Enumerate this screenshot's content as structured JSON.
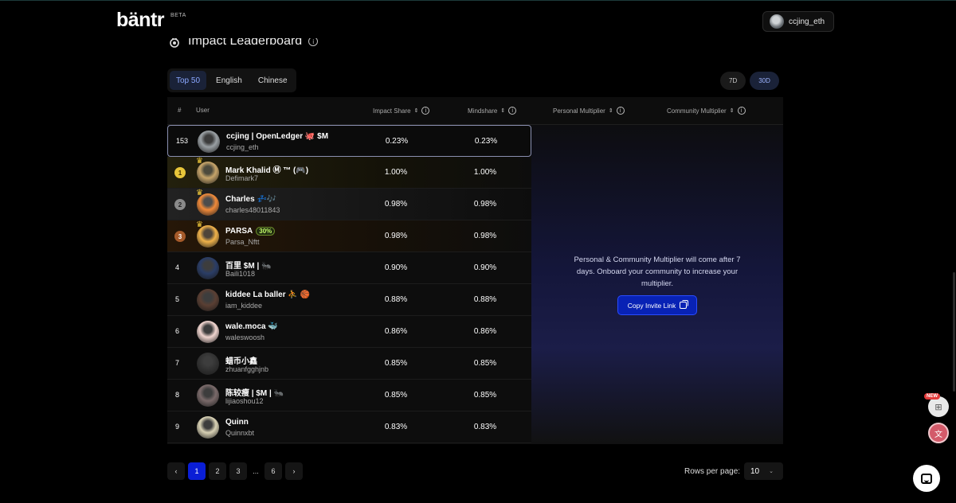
{
  "app": {
    "logo": "bäntr",
    "beta": "BETA"
  },
  "header": {
    "username": "ccjing_eth"
  },
  "page": {
    "title": "Impact Leaderboard"
  },
  "tabs": [
    {
      "label": "Top 50",
      "active": true
    },
    {
      "label": "English",
      "active": false
    },
    {
      "label": "Chinese",
      "active": false
    }
  ],
  "periods": [
    {
      "label": "7D",
      "active": false
    },
    {
      "label": "30D",
      "active": true
    }
  ],
  "columns": {
    "rank": "#",
    "user": "User",
    "impact_share": "Impact Share",
    "mindshare": "Mindshare",
    "personal_multiplier": "Personal Multiplier",
    "community_multiplier": "Community Multiplier"
  },
  "rows": [
    {
      "rank": "153",
      "name": "ccjing | OpenLedger 🐙 $M",
      "handle": "ccjing_eth",
      "impact": "0.23%",
      "mindshare": "0.23%",
      "style": "self",
      "avatar_color": "#9aa0a4"
    },
    {
      "rank": "1",
      "name": "Mark Khalid Ⓜ ™ (🎮)",
      "handle": "Defimark7",
      "impact": "1.00%",
      "mindshare": "1.00%",
      "style": "gold",
      "avatar_color": "#c7a56a"
    },
    {
      "rank": "2",
      "name": "Charles 💤🎶",
      "handle": "charles48011843",
      "impact": "0.98%",
      "mindshare": "0.98%",
      "style": "silver",
      "avatar_color": "#f08a3a"
    },
    {
      "rank": "3",
      "name": "PARSA",
      "badge": "30%",
      "handle": "Parsa_Nftt",
      "impact": "0.98%",
      "mindshare": "0.98%",
      "style": "bronze",
      "avatar_color": "#f0b24a"
    },
    {
      "rank": "4",
      "name": "百里 $M | 🐜",
      "handle": "Baili1018",
      "impact": "0.90%",
      "mindshare": "0.90%",
      "style": "normal",
      "avatar_color": "#2a3d66"
    },
    {
      "rank": "5",
      "name": "kiddee La baller ⛹ 🏀",
      "handle": "iam_kiddee",
      "impact": "0.88%",
      "mindshare": "0.88%",
      "style": "normal",
      "avatar_color": "#5a3f33"
    },
    {
      "rank": "6",
      "name": "wale.moca 🐳",
      "handle": "waleswoosh",
      "impact": "0.86%",
      "mindshare": "0.86%",
      "style": "normal",
      "avatar_color": "#f1d6d0"
    },
    {
      "rank": "7",
      "name": "蜡币小鑫",
      "handle": "zhuanfgghjnb",
      "impact": "0.85%",
      "mindshare": "0.85%",
      "style": "normal",
      "avatar_color": "#333333"
    },
    {
      "rank": "8",
      "name": "陈较瘦 | $M | 🐜",
      "handle": "lijiaoshou12",
      "impact": "0.85%",
      "mindshare": "0.85%",
      "style": "normal",
      "avatar_color": "#7a6a6a"
    },
    {
      "rank": "9",
      "name": "Quinn",
      "handle": "Quinnxbt",
      "impact": "0.83%",
      "mindshare": "0.83%",
      "style": "normal",
      "avatar_color": "#d9d2b5"
    }
  ],
  "multiplier_panel": {
    "message": "Personal & Community Multiplier will come after 7 days. Onboard your community to increase your multiplier.",
    "button": "Copy Invite Link"
  },
  "pagination": {
    "prev": "‹",
    "next": "›",
    "pages": [
      "1",
      "2",
      "3",
      "...",
      "6"
    ],
    "current": "1",
    "rows_per_page_label": "Rows per page:",
    "rows_per_page": "10"
  },
  "widgets": {
    "new_tag": "NEW"
  }
}
